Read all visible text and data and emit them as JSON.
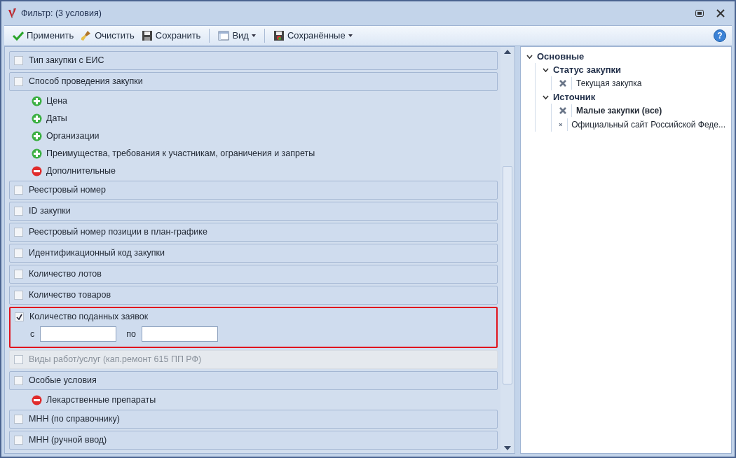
{
  "window": {
    "title": "Фильтр: (3 условия)"
  },
  "toolbar": {
    "groups": [
      [
        {
          "label": "Применить",
          "kind": "apply",
          "dropdown": false
        },
        {
          "label": "Очистить",
          "kind": "clear",
          "dropdown": false
        },
        {
          "label": "Сохранить",
          "kind": "save",
          "dropdown": false
        }
      ],
      [
        {
          "label": "Вид",
          "kind": "view",
          "dropdown": true
        }
      ],
      [
        {
          "label": "Сохранённые",
          "kind": "saved",
          "dropdown": true
        }
      ]
    ],
    "help": "?"
  },
  "filters": [
    {
      "kind": "filter",
      "label": "Тип закупки с ЕИС",
      "checked": false,
      "disabled": false,
      "highlighted": false
    },
    {
      "kind": "filter",
      "label": "Способ проведения закупки",
      "checked": false,
      "disabled": false,
      "highlighted": false
    },
    {
      "kind": "group",
      "label": "Цена",
      "expanded": false
    },
    {
      "kind": "group",
      "label": "Даты",
      "expanded": false
    },
    {
      "kind": "group",
      "label": "Организации",
      "expanded": false
    },
    {
      "kind": "group",
      "label": "Преимущества, требования к участникам, ограничения и запреты",
      "expanded": false
    },
    {
      "kind": "group",
      "label": "Дополнительные",
      "expanded": true
    },
    {
      "kind": "filter",
      "label": "Реестровый номер",
      "checked": false,
      "disabled": false,
      "highlighted": false
    },
    {
      "kind": "filter",
      "label": "ID закупки",
      "checked": false,
      "disabled": false,
      "highlighted": false
    },
    {
      "kind": "filter",
      "label": "Реестровый номер позиции в план-графике",
      "checked": false,
      "disabled": false,
      "highlighted": false
    },
    {
      "kind": "filter",
      "label": "Идентификационный код закупки",
      "checked": false,
      "disabled": false,
      "highlighted": false
    },
    {
      "kind": "filter",
      "label": "Количество лотов",
      "checked": false,
      "disabled": false,
      "highlighted": false
    },
    {
      "kind": "filter",
      "label": "Количество товаров",
      "checked": false,
      "disabled": false,
      "highlighted": false
    },
    {
      "kind": "filter",
      "label": "Количество поданных заявок",
      "checked": true,
      "disabled": false,
      "highlighted": true,
      "range": {
        "from_label": "с",
        "to_label": "по"
      }
    },
    {
      "kind": "filter",
      "label": "Виды работ/услуг (кап.ремонт 615 ПП РФ)",
      "checked": false,
      "disabled": true,
      "highlighted": false
    },
    {
      "kind": "filter",
      "label": "Особые условия",
      "checked": false,
      "disabled": false,
      "highlighted": false
    },
    {
      "kind": "group",
      "label": "Лекарственные препараты",
      "expanded": true
    },
    {
      "kind": "filter",
      "label": "МНН (по справочнику)",
      "checked": false,
      "disabled": false,
      "highlighted": false
    },
    {
      "kind": "filter",
      "label": "МНН (ручной ввод)",
      "checked": false,
      "disabled": false,
      "highlighted": false
    }
  ],
  "summary": [
    {
      "label": "Основные",
      "expanded": true,
      "children": [
        {
          "label": "Статус закупки",
          "expanded": true,
          "children": [
            {
              "label": "Текущая закупка",
              "bold": false
            }
          ]
        },
        {
          "label": "Источник",
          "expanded": true,
          "children": [
            {
              "label": "Малые закупки (все)",
              "bold": true
            },
            {
              "label": "Официальный сайт Российской Феде...",
              "bold": false
            }
          ]
        }
      ]
    }
  ]
}
